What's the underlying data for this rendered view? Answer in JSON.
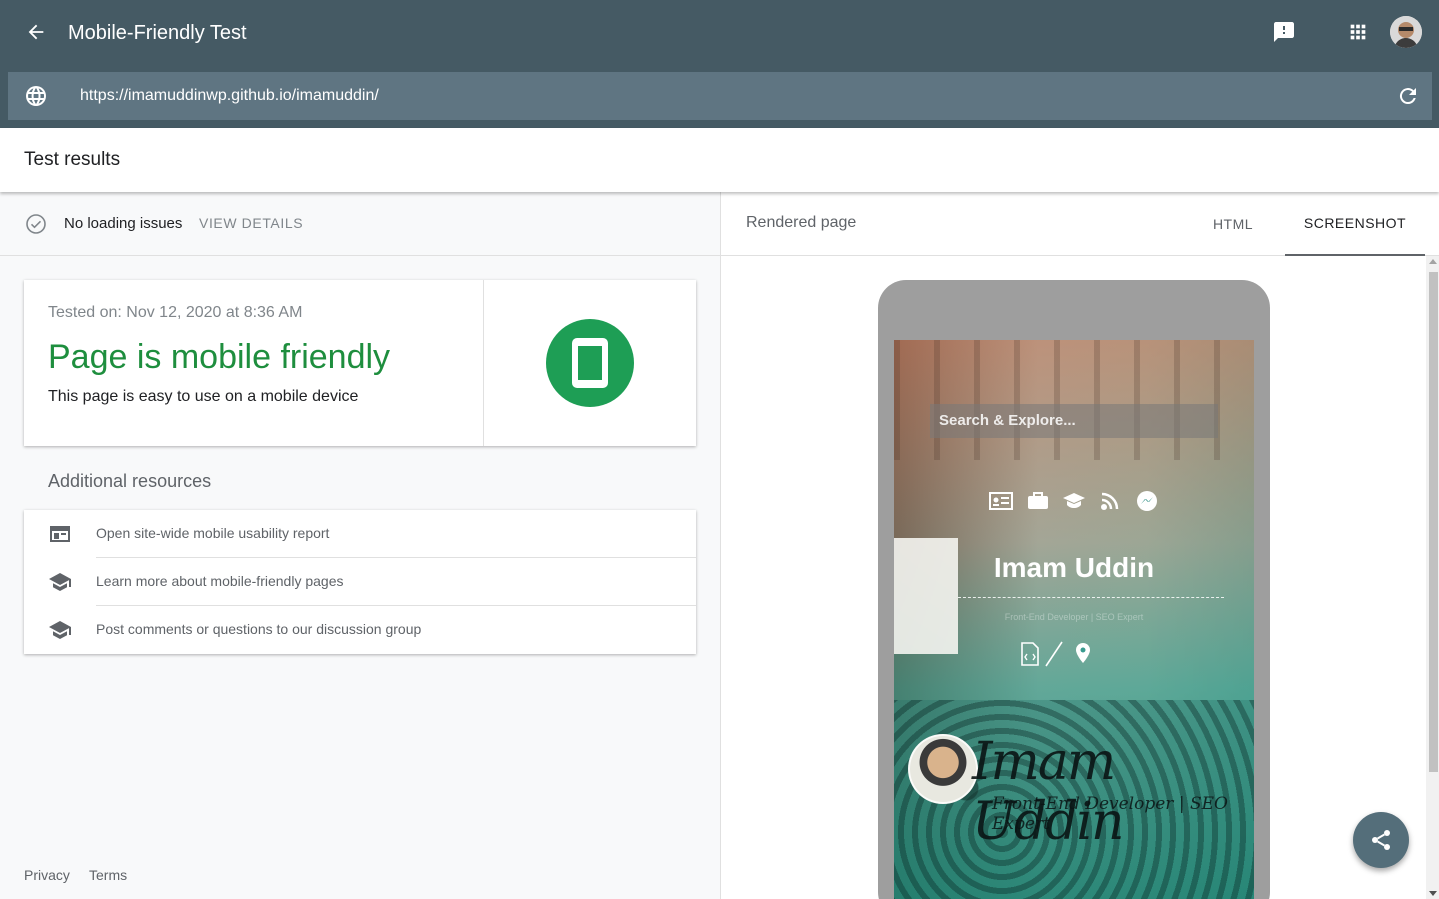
{
  "header": {
    "title": "Mobile-Friendly Test",
    "url": "https://imamuddinwp.github.io/imamuddin/"
  },
  "results": {
    "title": "Test results",
    "loading_status": "No loading issues",
    "view_details": "VIEW DETAILS",
    "tested_on": "Tested on: Nov 12, 2020 at 8:36 AM",
    "verdict": "Page is mobile friendly",
    "verdict_sub": "This page is easy to use on a mobile device",
    "verdict_color": "#1e8e3e"
  },
  "additional": {
    "title": "Additional resources",
    "items": [
      {
        "label": "Open site-wide mobile usability report",
        "icon": "web-report-icon"
      },
      {
        "label": "Learn more about mobile-friendly pages",
        "icon": "school-icon"
      },
      {
        "label": "Post comments or questions to our discussion group",
        "icon": "school-icon"
      }
    ]
  },
  "footer": {
    "privacy": "Privacy",
    "terms": "Terms"
  },
  "rendered": {
    "label": "Rendered page",
    "tabs": [
      {
        "label": "HTML",
        "selected": false
      },
      {
        "label": "SCREENSHOT",
        "selected": true
      }
    ],
    "screenshot": {
      "search_placeholder": "Search & Explore...",
      "name": "Imam Uddin",
      "tagline": "Front-End Developer | SEO Expert",
      "signature": "Imam Uddin",
      "role": "Front-End Developer | SEO Expert"
    }
  },
  "colors": {
    "appbar": "#455a64",
    "urlbar": "#5f7582",
    "accent_green": "#1e9e55",
    "fab": "#546e7a"
  }
}
